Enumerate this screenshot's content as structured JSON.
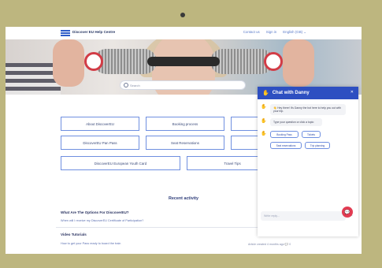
{
  "colors": {
    "accent": "#2d4fc1",
    "tile_border": "#6f8fe0",
    "fab": "#e23c52"
  },
  "header": {
    "brand": "Discover EU Help Centre",
    "nav": [
      "Contact us",
      "Sign in",
      "English (GB) ⌄"
    ]
  },
  "search": {
    "placeholder": "Search"
  },
  "tiles": [
    "About DiscoverEU",
    "Booking process",
    "Travel Ex",
    "DiscoverEU Pan Pass",
    "Seat Reservations",
    "Eli",
    "DiscoverEU European Youth Card",
    "Travel Tips"
  ],
  "recent": {
    "title": "Recent activity",
    "items": [
      {
        "question": "What Are The Options For DiscoverEU?",
        "answer": "When will I receive my DiscoverEU Certificate of Participation?"
      },
      {
        "question": "Video Tutorials",
        "answer": "How to get your Pass ready to board the train"
      }
    ],
    "meta": "Article created 4 months ago  💬 0"
  },
  "chat": {
    "title": "Chat with Danny",
    "messages": [
      "👋 Hey there! It's Danny the bot here to help you out with your trip.",
      "Type your question or click a topic:"
    ],
    "options": [
      "Booking Pass",
      "Tickets",
      "Seat reservations",
      "Trip planning"
    ],
    "reply_placeholder": "Write reply..."
  }
}
